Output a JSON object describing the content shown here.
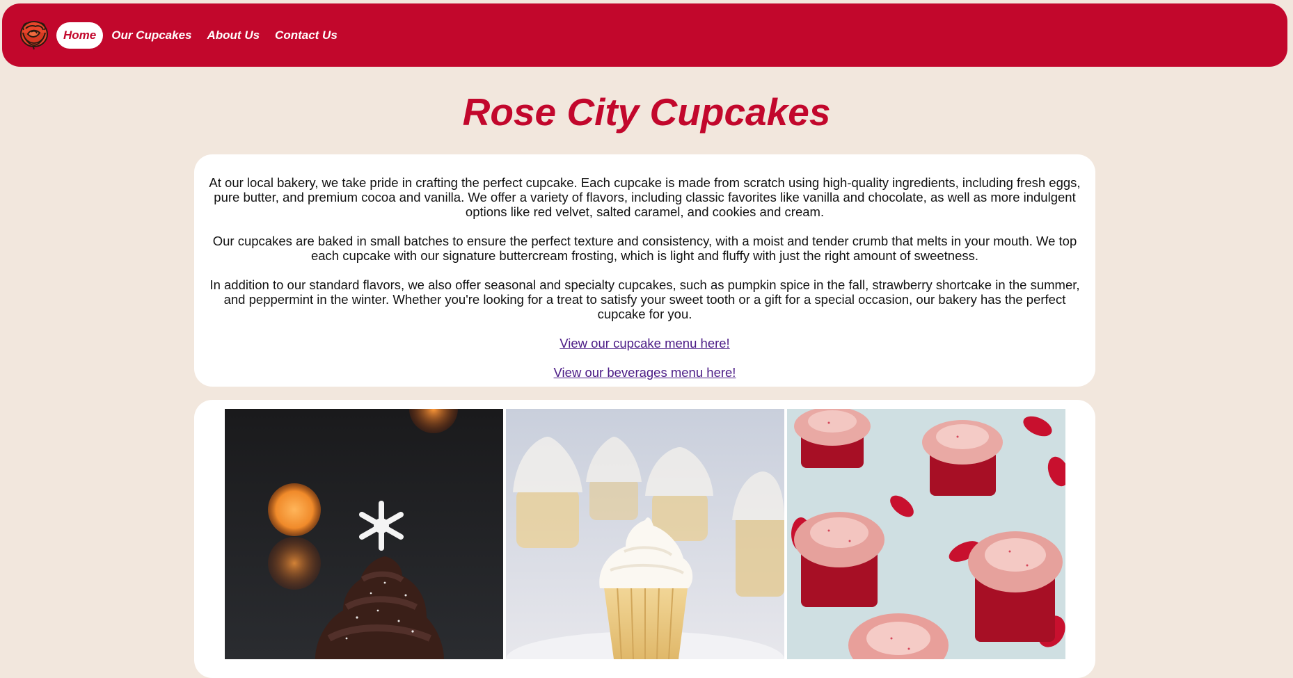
{
  "nav": {
    "logo_icon": "rose-logo-icon",
    "items": [
      {
        "label": "Home",
        "active": true
      },
      {
        "label": "Our Cupcakes",
        "active": false
      },
      {
        "label": "About Us",
        "active": false
      },
      {
        "label": "Contact Us",
        "active": false
      }
    ]
  },
  "hero": {
    "title": "Rose City Cupcakes"
  },
  "intro": {
    "paragraphs": [
      "At our local bakery, we take pride in crafting the perfect cupcake. Each cupcake is made from scratch using high-quality ingredients, including fresh eggs, pure butter, and premium cocoa and vanilla. We offer a variety of flavors, including classic favorites like vanilla and chocolate, as well as more indulgent options like red velvet, salted caramel, and cookies and cream.",
      "Our cupcakes are baked in small batches to ensure the perfect texture and consistency, with a moist and tender crumb that melts in your mouth. We top each cupcake with our signature buttercream frosting, which is light and fluffy with just the right amount of sweetness.",
      "In addition to our standard flavors, we also offer seasonal and specialty cupcakes, such as pumpkin spice in the fall, strawberry shortcake in the summer, and peppermint in the winter. Whether you're looking for a treat to satisfy your sweet tooth or a gift for a special occasion, our bakery has the perfect cupcake for you."
    ],
    "cupcake_menu_link": "View our cupcake menu here!",
    "beverages_menu_link": "View our beverages menu here!"
  },
  "gallery": {
    "photos": [
      {
        "subject": "chocolate-cupcake-snowflake-photo"
      },
      {
        "subject": "vanilla-cupcakes-photo"
      },
      {
        "subject": "red-velvet-cupcakes-photo"
      }
    ]
  },
  "colors": {
    "brand_red": "#c2072c",
    "page_background": "#f2e7dd",
    "link_visited": "#4a1a85"
  }
}
